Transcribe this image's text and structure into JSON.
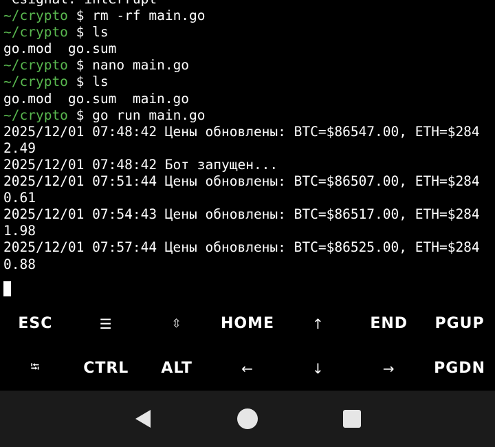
{
  "terminal": {
    "lines": [
      {
        "type": "output",
        "text": "^Csignal: interrupt"
      },
      {
        "type": "prompt",
        "path": "~/crypto",
        "symbol": "$",
        "command": "rm -rf main.go"
      },
      {
        "type": "prompt",
        "path": "~/crypto",
        "symbol": "$",
        "command": "ls"
      },
      {
        "type": "output",
        "text": "go.mod  go.sum"
      },
      {
        "type": "prompt",
        "path": "~/crypto",
        "symbol": "$",
        "command": "nano main.go"
      },
      {
        "type": "prompt",
        "path": "~/crypto",
        "symbol": "$",
        "command": "ls"
      },
      {
        "type": "output",
        "text": "go.mod  go.sum  main.go"
      },
      {
        "type": "prompt",
        "path": "~/crypto",
        "symbol": "$",
        "command": "go run main.go"
      },
      {
        "type": "output",
        "text": "2025/12/01 07:48:42 Цены обновлены: BTC=$86547.00, ETH=$284"
      },
      {
        "type": "output",
        "text": "2.49"
      },
      {
        "type": "output",
        "text": "2025/12/01 07:48:42 Бот запущен..."
      },
      {
        "type": "output",
        "text": "2025/12/01 07:51:44 Цены обновлены: BTC=$86507.00, ETH=$284"
      },
      {
        "type": "output",
        "text": "0.61"
      },
      {
        "type": "output",
        "text": "2025/12/01 07:54:43 Цены обновлены: BTC=$86517.00, ETH=$284"
      },
      {
        "type": "output",
        "text": "1.98"
      },
      {
        "type": "output",
        "text": "2025/12/01 07:57:44 Цены обновлены: BTC=$86525.00, ETH=$284"
      },
      {
        "type": "output",
        "text": "0.88"
      },
      {
        "type": "cursor"
      }
    ]
  },
  "extra_keys": {
    "row1": [
      {
        "name": "esc-key",
        "label": "ESC",
        "style": "text"
      },
      {
        "name": "drawer-menu-key",
        "label": "☰",
        "style": "arrow"
      },
      {
        "name": "scroll-toggle-key",
        "label": "⇳",
        "style": "small"
      },
      {
        "name": "home-key",
        "label": "HOME",
        "style": "text"
      },
      {
        "name": "arrow-up-key",
        "label": "↑",
        "style": "arrow"
      },
      {
        "name": "end-key",
        "label": "END",
        "style": "text"
      },
      {
        "name": "pgup-key",
        "label": "PGUP",
        "style": "text"
      }
    ],
    "row2": [
      {
        "name": "tab-key",
        "label": "⭾",
        "style": "small"
      },
      {
        "name": "ctrl-key",
        "label": "CTRL",
        "style": "text"
      },
      {
        "name": "alt-key",
        "label": "ALT",
        "style": "text"
      },
      {
        "name": "arrow-left-key",
        "label": "←",
        "style": "arrow"
      },
      {
        "name": "arrow-down-key",
        "label": "↓",
        "style": "arrow"
      },
      {
        "name": "arrow-right-key",
        "label": "→",
        "style": "arrow"
      },
      {
        "name": "pgdn-key",
        "label": "PGDN",
        "style": "text"
      }
    ]
  },
  "nav_bar": {
    "buttons": [
      "back-icon",
      "home-icon",
      "recents-icon"
    ]
  },
  "colors": {
    "prompt_path": "#59b84f",
    "text": "#ffffff",
    "background": "#000000",
    "nav_background": "#1b1b1b",
    "nav_icon": "#e6e6e6"
  }
}
